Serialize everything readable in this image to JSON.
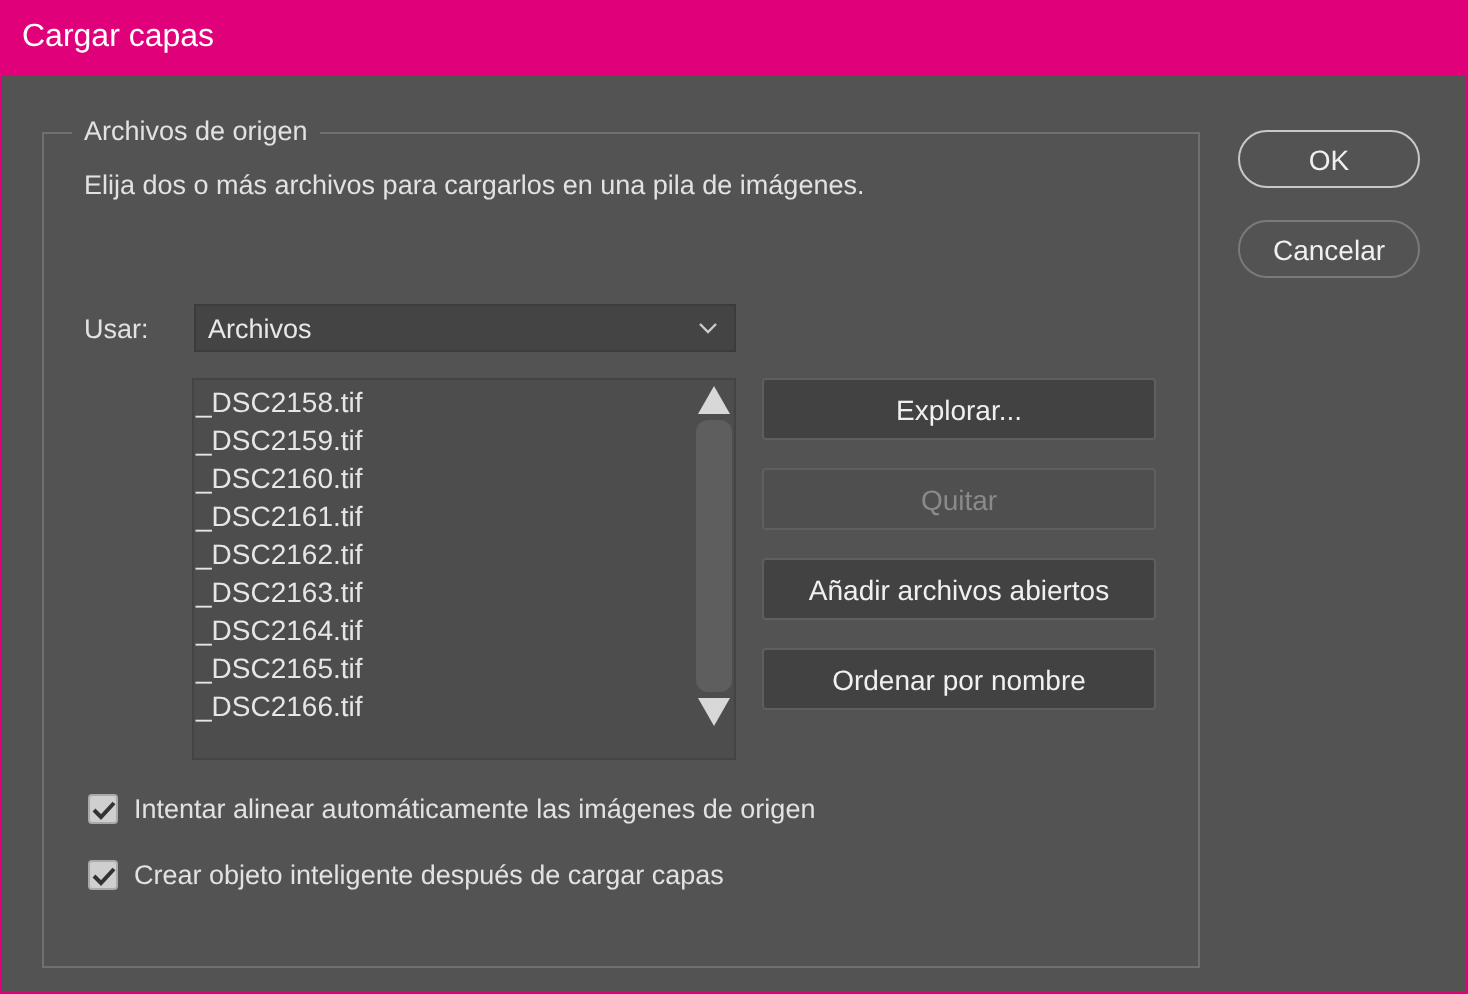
{
  "window": {
    "title": "Cargar capas"
  },
  "group": {
    "title": "Archivos de origen",
    "description": "Elija dos o más archivos para cargarlos en una pila de imágenes."
  },
  "use": {
    "label": "Usar:",
    "value": "Archivos"
  },
  "files": [
    "_DSC2158.tif",
    "_DSC2159.tif",
    "_DSC2160.tif",
    "_DSC2161.tif",
    "_DSC2162.tif",
    "_DSC2163.tif",
    "_DSC2164.tif",
    "_DSC2165.tif",
    "_DSC2166.tif"
  ],
  "list_buttons": [
    {
      "label": "Explorar...",
      "disabled": false
    },
    {
      "label": "Quitar",
      "disabled": true
    },
    {
      "label": "Añadir archivos abiertos",
      "disabled": false
    },
    {
      "label": "Ordenar por nombre",
      "disabled": false
    }
  ],
  "options": [
    {
      "label": "Intentar alinear automáticamente las imágenes de origen",
      "checked": true
    },
    {
      "label": "Crear objeto inteligente después de cargar capas",
      "checked": true
    }
  ],
  "buttons": [
    "OK",
    "Cancelar"
  ]
}
